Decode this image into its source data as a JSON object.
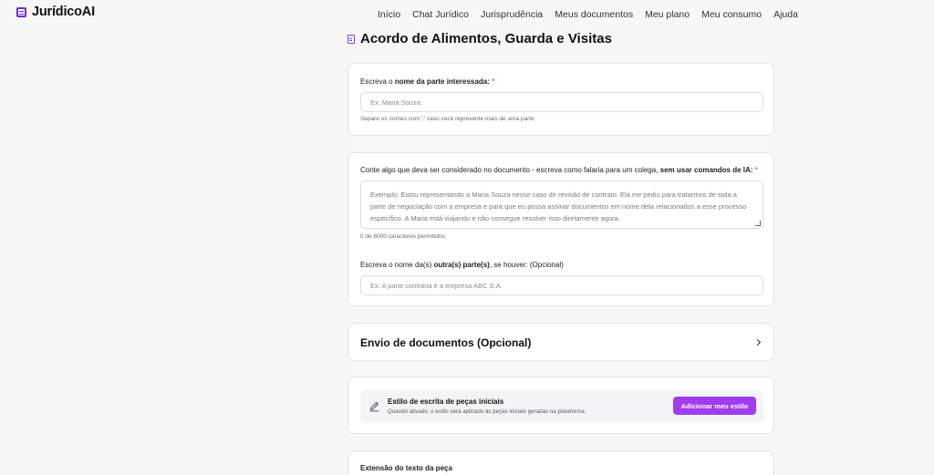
{
  "brand": {
    "name": "JurídicoAI"
  },
  "nav": {
    "items": [
      "Início",
      "Chat Jurídico",
      "Jurisprudência",
      "Meus documentos",
      "Meu plano",
      "Meu consumo",
      "Ajuda"
    ]
  },
  "page": {
    "title": "Acordo de Alimentos, Guarda e Visitas"
  },
  "party": {
    "label_prefix": "Escreva o ",
    "label_bold": "nome da parte interessada:",
    "required_mark": "*",
    "placeholder": "Ex: Maria Souza.",
    "hint": "Separe os nomes com ';' caso você represente mais de uma parte"
  },
  "context": {
    "label_prefix": "Conte algo que deva ser considerado no documento - escreva como falaria para um colega, ",
    "label_bold": "sem usar comandos de IA:",
    "required_mark": "*",
    "placeholder": "Exemplo: Estou representando a Maria Souza nesse caso de revisão de contrato. Ela me pediu para tratarmos de toda a parte de negociação com a empresa e para que eu possa assinar documentos em nome dela relacionados a esse processo específico. A Maria está viajando e não consegue resolver isso diretamente agora.",
    "char_count": "0 de 6000 caracteres permitidos."
  },
  "other_party": {
    "label_prefix": "Escreva o nome da(s) ",
    "label_bold": "outra(s) parte(s)",
    "label_suffix": ", se houver: (Opcional)",
    "placeholder": "Ex: A parte contrária é a empresa ABC S.A."
  },
  "documents": {
    "title": "Envio de documentos (Opcional)",
    "icon": "chevron-right-icon"
  },
  "writing_style": {
    "title": "Estilo de escrita de peças iniciais",
    "description": "Quando ativado, o estilo será aplicado às peças iniciais geradas na plataforma.",
    "button": "Adicionar meu estilo",
    "icon": "pen-icon",
    "accent": "#a23cf0"
  },
  "length": {
    "label": "Extensão do texto da peça"
  }
}
